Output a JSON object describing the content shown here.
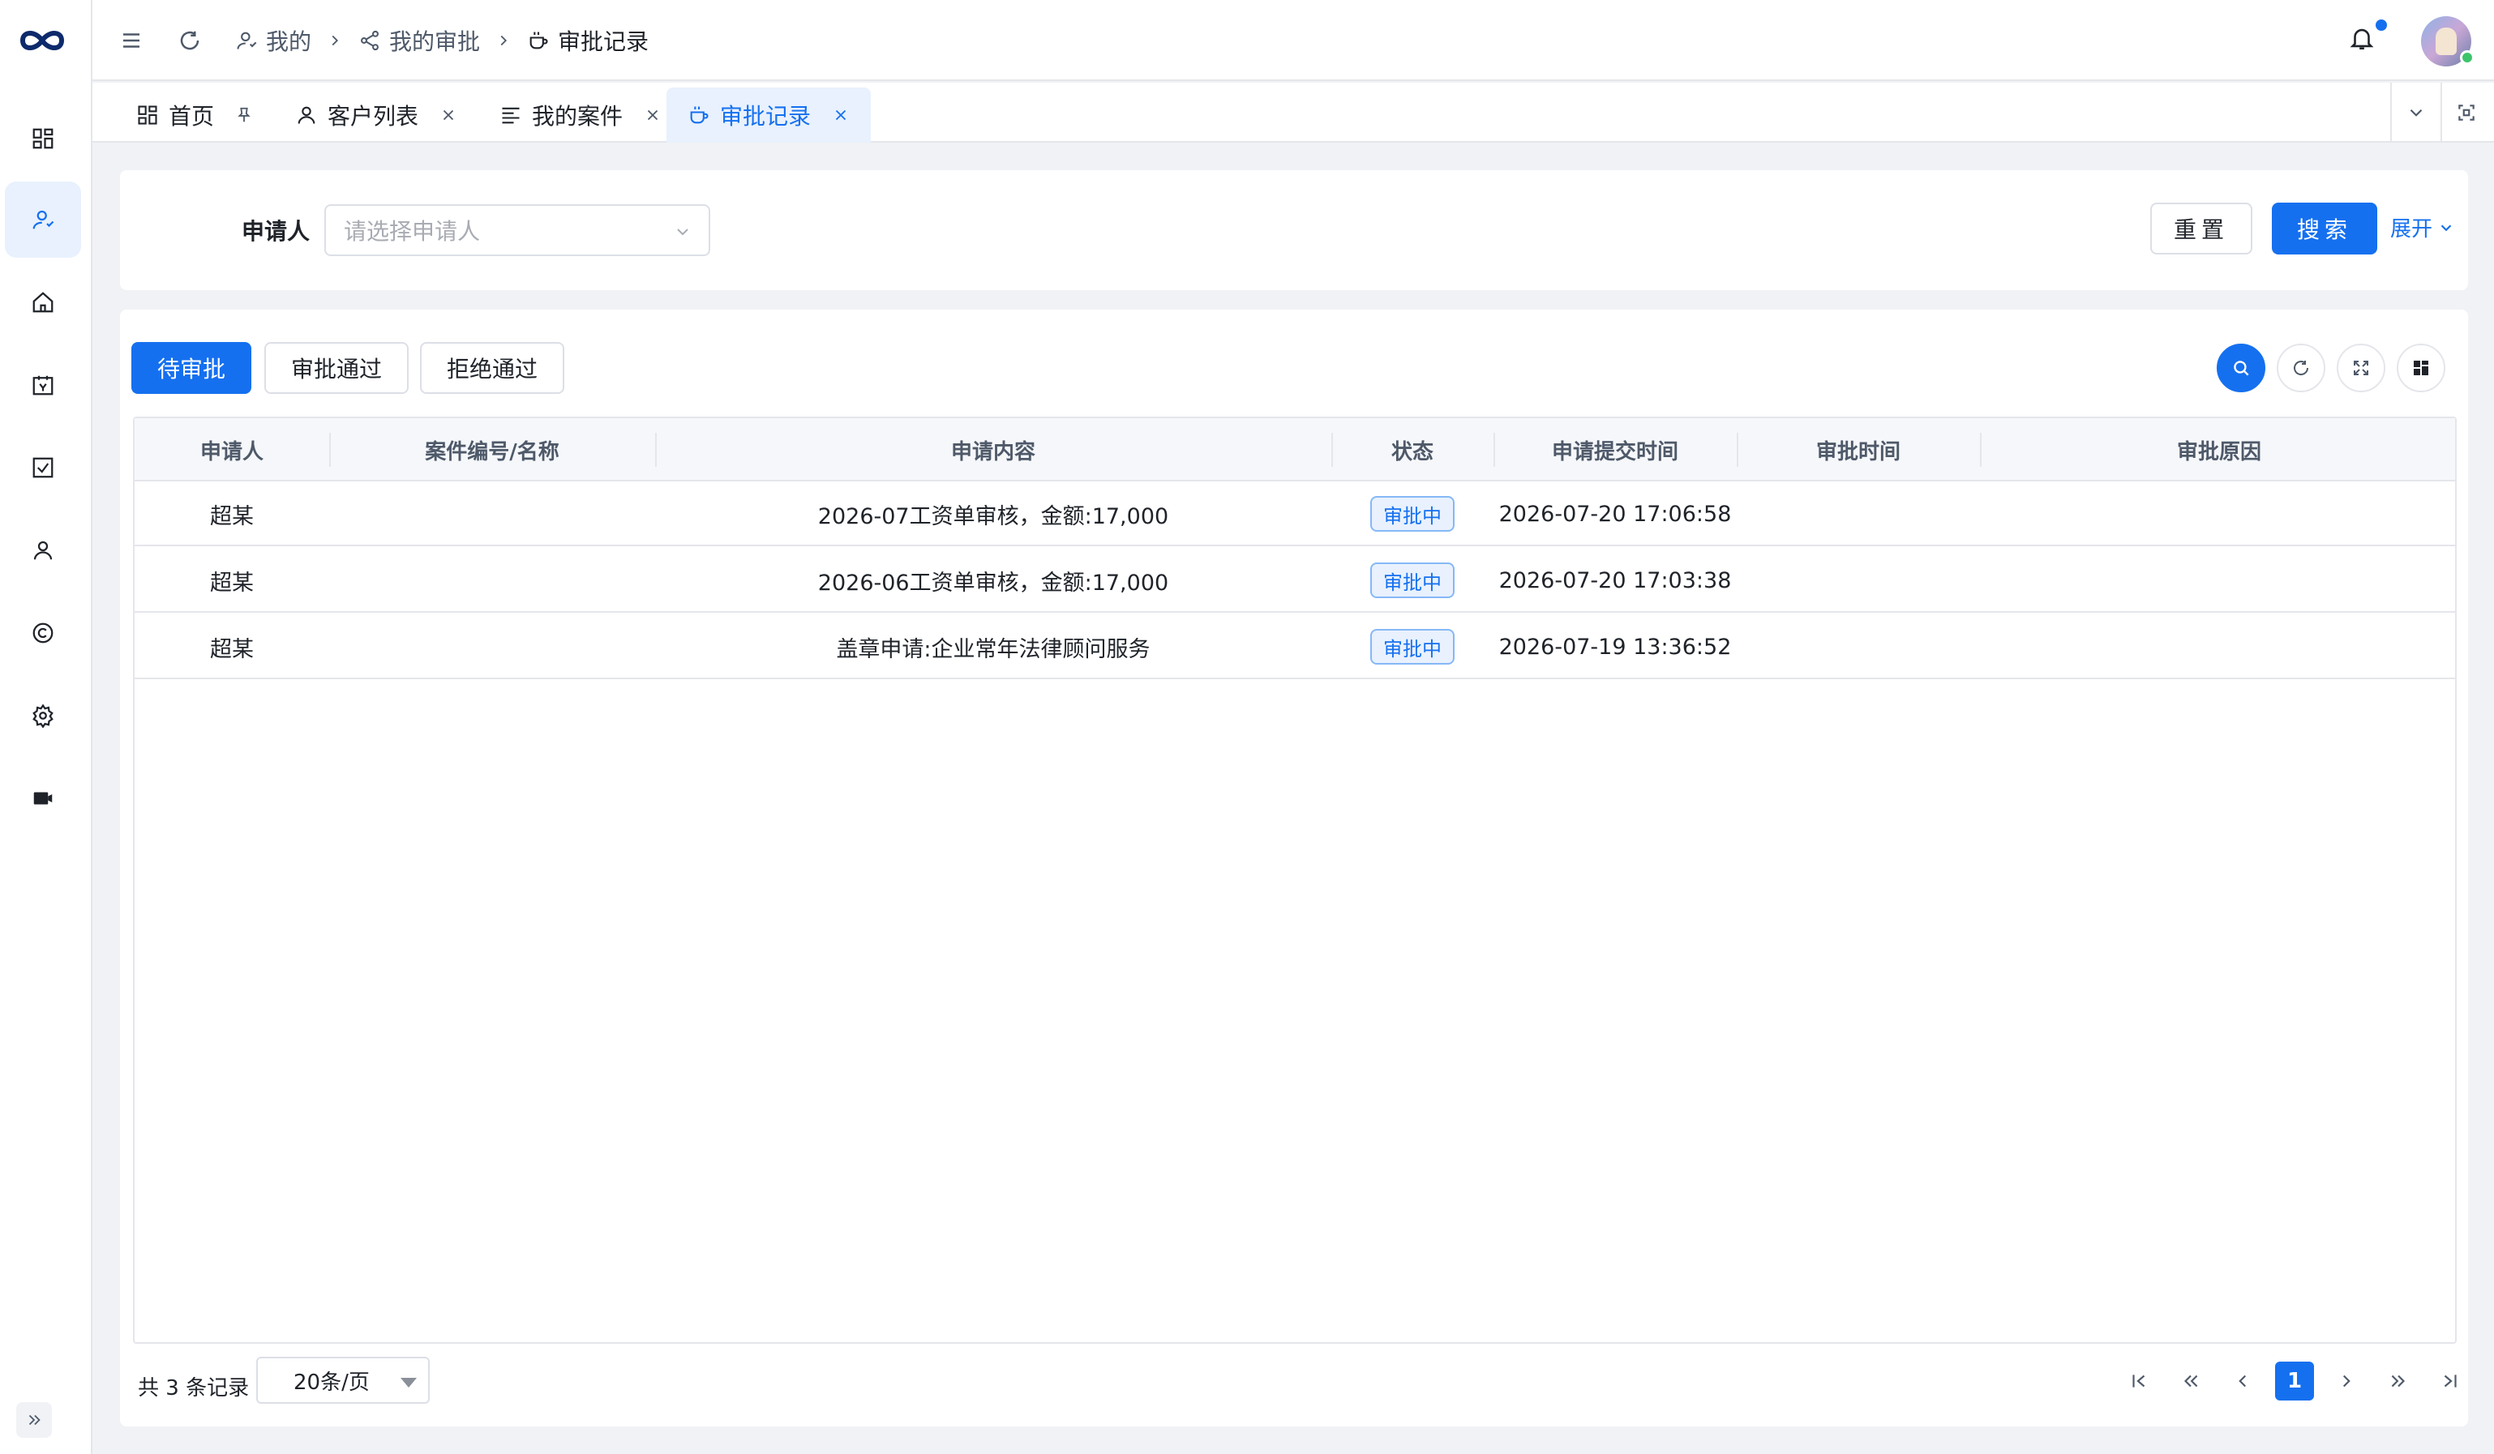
{
  "breadcrumb": {
    "items": [
      {
        "label": "我的"
      },
      {
        "label": "我的审批"
      },
      {
        "label": "审批记录"
      }
    ]
  },
  "tabs": [
    {
      "label": "首页"
    },
    {
      "label": "客户列表"
    },
    {
      "label": "我的案件"
    },
    {
      "label": "审批记录"
    }
  ],
  "search": {
    "applicant_label": "申请人",
    "applicant_placeholder": "请选择申请人",
    "reset_label": "重置",
    "search_label": "搜索",
    "expand_label": "展开"
  },
  "filter_tabs": [
    {
      "label": "待审批",
      "active": true
    },
    {
      "label": "审批通过",
      "active": false
    },
    {
      "label": "拒绝通过",
      "active": false
    }
  ],
  "table": {
    "columns": [
      "申请人",
      "案件编号/名称",
      "申请内容",
      "状态",
      "申请提交时间",
      "审批时间",
      "审批原因"
    ],
    "rows": [
      {
        "applicant": "超某",
        "case": "",
        "content": "2026-07工资单审核，金额:17,000",
        "status": "审批中",
        "submitted": "2026-07-20 17:06:58",
        "approved": "",
        "reason": ""
      },
      {
        "applicant": "超某",
        "case": "",
        "content": "2026-06工资单审核，金额:17,000",
        "status": "审批中",
        "submitted": "2026-07-20 17:03:38",
        "approved": "",
        "reason": ""
      },
      {
        "applicant": "超某",
        "case": "",
        "content": "盖章申请:企业常年法律顾问服务",
        "status": "审批中",
        "submitted": "2026-07-19 13:36:52",
        "approved": "",
        "reason": ""
      }
    ]
  },
  "pagination": {
    "total_text": "共 3 条记录",
    "page_size": "20条/页",
    "current_page": "1"
  },
  "colors": {
    "primary": "#1570ef",
    "active_bg": "#e8f1fd",
    "border": "#e5e6eb"
  }
}
